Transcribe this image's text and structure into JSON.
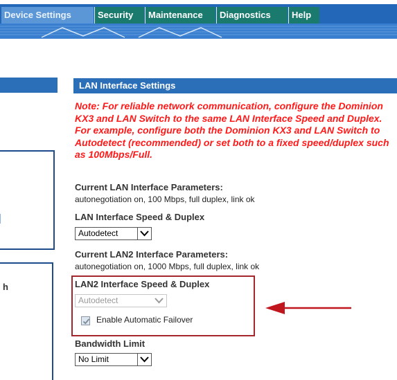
{
  "nav": {
    "tabs": [
      {
        "label": "Device Settings",
        "active": true
      },
      {
        "label": "Security",
        "active": false
      },
      {
        "label": "Maintenance",
        "active": false
      },
      {
        "label": "Diagnostics",
        "active": false
      },
      {
        "label": "Help",
        "active": false
      }
    ]
  },
  "left": {
    "fragment_text": "h"
  },
  "section": {
    "header": "LAN Interface Settings",
    "note": "Note: For reliable network communication, configure the Dominion KX3 and LAN Switch to the same LAN Interface Speed and Duplex. For example, configure both the Dominion KX3 and LAN Switch to Autodetect (recommended) or set both to a fixed speed/duplex such as 100Mbps/Full.",
    "lan1": {
      "params_label": "Current LAN Interface Parameters:",
      "params_value": "autonegotiation on, 100 Mbps, full duplex, link ok",
      "speed_label": "LAN Interface Speed & Duplex",
      "speed_selected": "Autodetect"
    },
    "lan2": {
      "params_label": "Current LAN2 Interface Parameters:",
      "params_value": "autonegotiation on, 1000 Mbps, full duplex, link ok",
      "speed_label": "LAN2 Interface Speed & Duplex",
      "speed_selected": "Autodetect",
      "speed_disabled": true,
      "failover_label": "Enable Automatic Failover",
      "failover_checked": true
    },
    "bandwidth": {
      "label": "Bandwidth Limit",
      "selected": "No Limit"
    }
  },
  "colors": {
    "nav_bg": "#2367b8",
    "tab_bg": "#1a7a6d",
    "tab_active_bg": "#5b96d6",
    "section_header_bg": "#2b6fb9",
    "note_text": "#ff1a1a",
    "highlight_border": "#a4262c",
    "annotation_arrow": "#c0171f"
  },
  "icons": {
    "dropdown": "chevron-down-icon",
    "checkbox_mark": "checkmark-icon",
    "annotation": "arrow-left-icon"
  }
}
